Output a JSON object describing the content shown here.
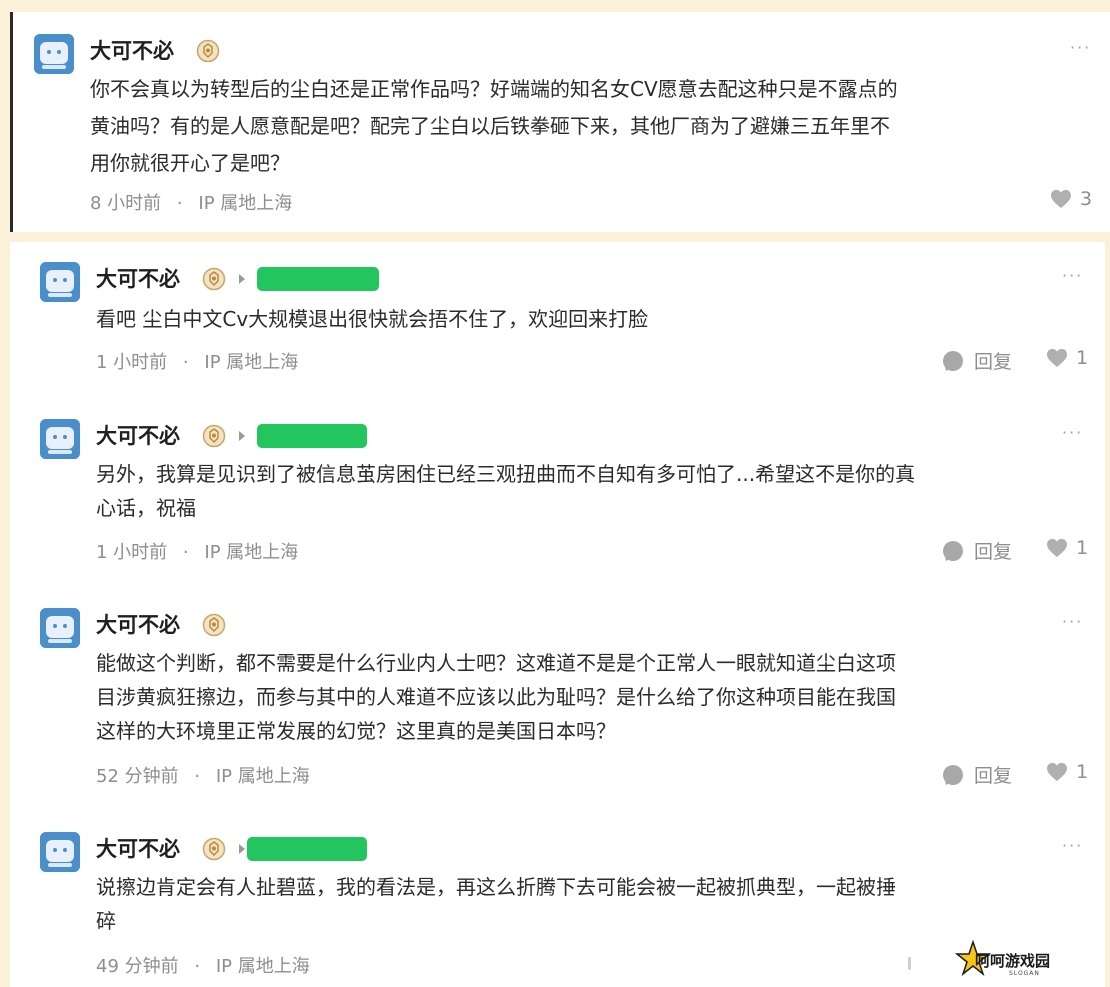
{
  "colors": {
    "page_background": "#fbf1d8",
    "card_background": "#ffffff",
    "highlight_bar": "#22c55e",
    "avatar": "#4a8fc9",
    "meta_text": "#8e8e8e"
  },
  "top_comment": {
    "username": "大可不必",
    "badge_icon": "level-badge-icon",
    "more_label": "···",
    "text_lines": [
      "你不会真以为转型后的尘白还是正常作品吗？好端端的知名女CV愿意去配这种只是不露点的",
      "黄油吗？有的是人愿意配是吧？配完了尘白以后铁拳砸下来，其他厂商为了避嫌三五年里不",
      "用你就很开心了是吧？"
    ],
    "time": "8 小时前",
    "separator": "·",
    "ip_location": "IP 属地上海",
    "like_count": "3"
  },
  "replies": [
    {
      "username": "大可不必",
      "has_reply_target": true,
      "more_label": "···",
      "text_lines": [
        "看吧 尘白中文Cv大规模退出很快就会捂不住了，欢迎回来打脸"
      ],
      "time": "1 小时前",
      "separator": "·",
      "ip_location": "IP 属地上海",
      "reply_label": "回复",
      "like_count": "1"
    },
    {
      "username": "大可不必",
      "has_reply_target": true,
      "more_label": "···",
      "text_lines": [
        "另外，我算是见识到了被信息茧房困住已经三观扭曲而不自知有多可怕了...希望这不是你的真",
        "心话，祝福"
      ],
      "time": "1 小时前",
      "separator": "·",
      "ip_location": "IP 属地上海",
      "reply_label": "回复",
      "like_count": "1"
    },
    {
      "username": "大可不必",
      "has_reply_target": false,
      "more_label": "···",
      "text_lines": [
        "能做这个判断，都不需要是什么行业内人士吧？这难道不是是个正常人一眼就知道尘白这项",
        "目涉黄疯狂擦边，而参与其中的人难道不应该以此为耻吗？是什么给了你这种项目能在我国",
        "这样的大环境里正常发展的幻觉？这里真的是美国日本吗？"
      ],
      "time": "52 分钟前",
      "separator": "·",
      "ip_location": "IP 属地上海",
      "reply_label": "回复",
      "like_count": "1"
    },
    {
      "username": "大可不必",
      "has_reply_target": true,
      "more_label": "···",
      "text_lines": [
        "说擦边肯定会有人扯碧蓝，我的看法是，再这么折腾下去可能会被一起被抓典型，一起被捶",
        "碎"
      ],
      "time": "49 分钟前",
      "separator": "·",
      "ip_location": "IP 属地上海"
    }
  ],
  "watermark": {
    "title": "呵呵游戏园",
    "subtitle": "SLOGAN"
  }
}
